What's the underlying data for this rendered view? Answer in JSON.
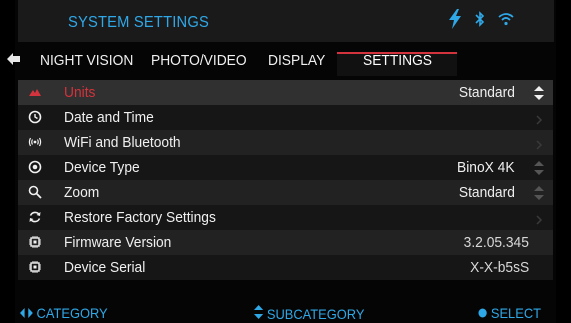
{
  "header": {
    "title": "SYSTEM SETTINGS",
    "icons": [
      "lightning-icon",
      "bluetooth-icon",
      "wifi-icon"
    ],
    "accent": "#2fa8e8"
  },
  "tabs": [
    {
      "label": "NIGHT VISION",
      "active": false
    },
    {
      "label": "PHOTO/VIDEO",
      "active": false
    },
    {
      "label": "DISPLAY",
      "active": false
    },
    {
      "label": "SETTINGS",
      "active": true
    }
  ],
  "settings": [
    {
      "label": "Units",
      "value": "Standard",
      "control": "updown",
      "selected": true,
      "icon": "units-icon"
    },
    {
      "label": "Date and Time",
      "value": "",
      "control": "chevron",
      "icon": "clock-icon"
    },
    {
      "label": "WiFi and Bluetooth",
      "value": "",
      "control": "chevron",
      "icon": "wireless-icon"
    },
    {
      "label": "Device Type",
      "value": "BinoX 4K",
      "control": "updown",
      "icon": "target-icon"
    },
    {
      "label": "Zoom",
      "value": "Standard",
      "control": "updown",
      "icon": "magnifier-icon"
    },
    {
      "label": "Restore Factory Settings",
      "value": "",
      "control": "chevron",
      "icon": "restore-icon"
    },
    {
      "label": "Firmware Version",
      "value": "3.2.05.345",
      "control": "none",
      "icon": "chip-icon"
    },
    {
      "label": "Device Serial",
      "value": "X-X-b5sS",
      "control": "none",
      "icon": "chip-icon"
    }
  ],
  "footer": {
    "category": "CATEGORY",
    "subcategory": "SUBCATEGORY",
    "select": "SELECT"
  },
  "colors": {
    "selected_text": "#d2333c",
    "active_tab_line": "#d2333c",
    "footer_text": "#2fa8e8"
  }
}
